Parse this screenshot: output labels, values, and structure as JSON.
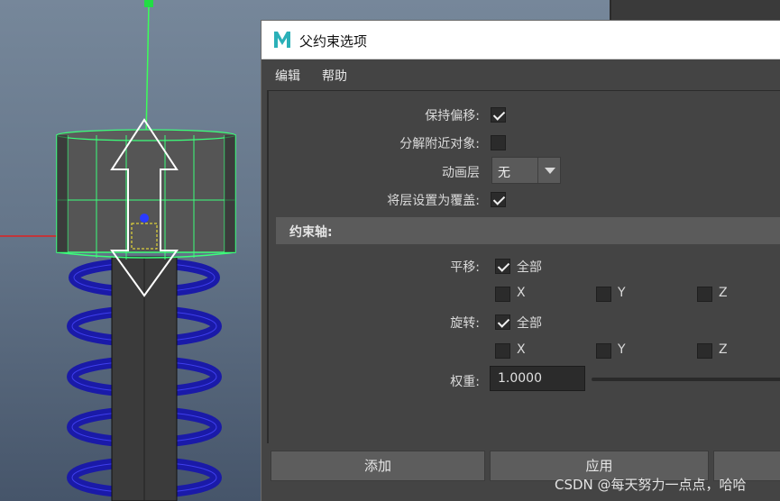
{
  "dialog": {
    "title": "父约束选项",
    "logo_letter": "M",
    "menu": [
      "编辑",
      "帮助"
    ]
  },
  "options": {
    "maintain_offset": {
      "label": "保持偏移:",
      "checked": true
    },
    "decompose_target": {
      "label": "分解附近对象:",
      "checked": false
    },
    "anim_layer": {
      "label": "动画层",
      "value": "无"
    },
    "layer_override": {
      "label": "将层设置为覆盖:",
      "checked": true
    }
  },
  "constraint_axes": {
    "title": "约束轴:",
    "translate": {
      "label": "平移:",
      "all_label": "全部",
      "all_checked": true,
      "axes": [
        "X",
        "Y",
        "Z"
      ]
    },
    "rotate": {
      "label": "旋转:",
      "all_label": "全部",
      "all_checked": true,
      "axes": [
        "X",
        "Y",
        "Z"
      ]
    },
    "weight": {
      "label": "权重:",
      "value": "1.0000"
    }
  },
  "buttons": {
    "add": "添加",
    "apply": "应用"
  },
  "watermark": "CSDN @每天努力一点点，哈哈",
  "colors": {
    "dialog_bg": "#444444",
    "wire_green": "#3cff7a",
    "spring_blue": "#1a1aa8"
  }
}
